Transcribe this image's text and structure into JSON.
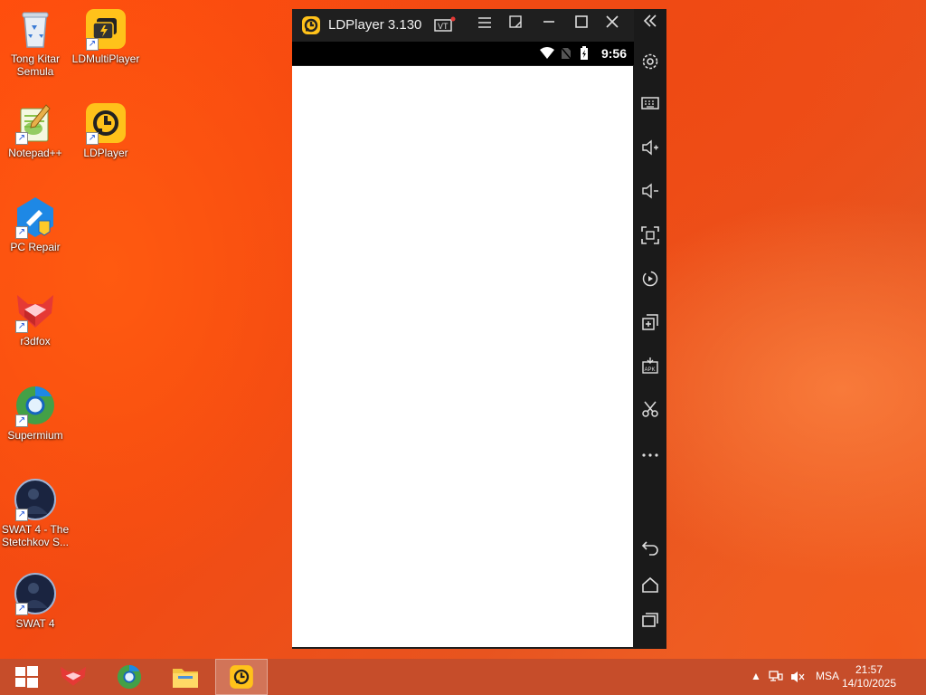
{
  "desktop": {
    "icons": [
      {
        "label": "Tong Kitar Semula",
        "icon": "recycle-bin-icon"
      },
      {
        "label": "LDMultiPlayer",
        "icon": "ldmultiplayer-icon"
      },
      {
        "label": "Notepad++",
        "icon": "notepadpp-icon"
      },
      {
        "label": "LDPlayer",
        "icon": "ldplayer-icon"
      },
      {
        "label": "PC Repair",
        "icon": "pc-repair-icon"
      },
      {
        "label": "r3dfox",
        "icon": "r3dfox-icon"
      },
      {
        "label": "Supermium",
        "icon": "supermium-icon"
      },
      {
        "label": "SWAT 4 - The Stetchkov S...",
        "icon": "swat4-expansion-icon"
      },
      {
        "label": "SWAT 4",
        "icon": "swat4-icon"
      }
    ]
  },
  "ldplayer": {
    "title": "LDPlayer 3.130",
    "status_time": "9:56",
    "accent": "#ffc21a"
  },
  "taskbar": {
    "tray_lang": "MSA",
    "clock_time": "21:57",
    "clock_date": "14/10/2025",
    "color": "#c64d2a"
  }
}
